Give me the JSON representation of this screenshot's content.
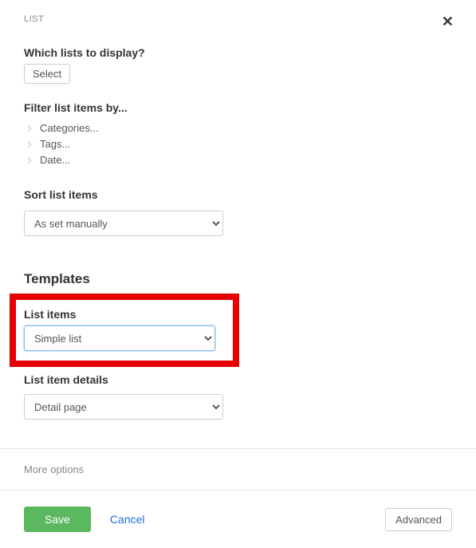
{
  "header": {
    "title": "LIST",
    "close_symbol": "✕"
  },
  "display": {
    "label": "Which lists to display?",
    "select_btn": "Select"
  },
  "filter": {
    "title": "Filter list items by...",
    "items": [
      {
        "label": "Categories..."
      },
      {
        "label": "Tags..."
      },
      {
        "label": "Date..."
      }
    ]
  },
  "sort": {
    "label": "Sort list items",
    "value": "As set manually"
  },
  "templates": {
    "heading": "Templates",
    "list_items_label": "List items",
    "list_items_value": "Simple list",
    "detail_label": "List item details",
    "detail_value": "Detail page"
  },
  "more_options": "More options",
  "footer": {
    "save": "Save",
    "cancel": "Cancel",
    "advanced": "Advanced"
  }
}
